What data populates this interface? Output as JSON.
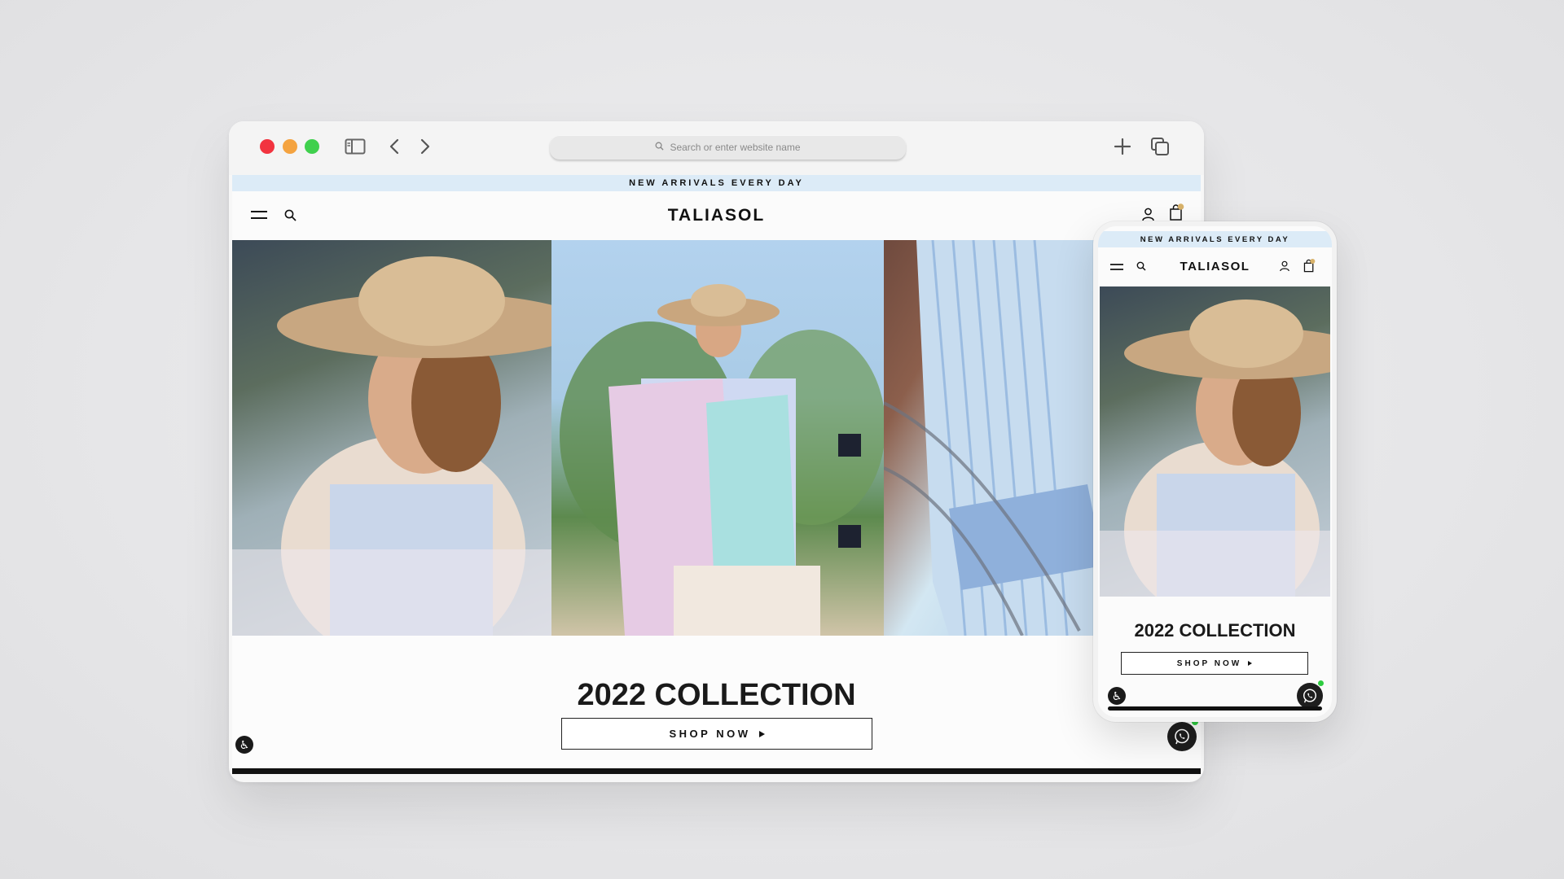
{
  "browser": {
    "address_placeholder": "Search or enter website name",
    "controls": {
      "close": "red-dot",
      "minimize": "yellow-dot",
      "zoom": "green-dot",
      "sidebar": "sidebar-icon",
      "back": "chevron-left-icon",
      "forward": "chevron-right-icon",
      "new_tab": "plus-icon",
      "tabs": "tabs-icon"
    }
  },
  "site": {
    "announcement": "NEW ARRIVALS EVERY DAY",
    "logo": "TALIASOL",
    "header_icons": [
      "menu-icon",
      "search-icon",
      "account-icon",
      "cart-icon"
    ],
    "collection_title": "2022 COLLECTION",
    "shop_now": "SHOP NOW",
    "floating": [
      "accessibility-icon",
      "whatsapp-icon"
    ]
  },
  "mobile": {
    "announcement": "NEW ARRIVALS EVERY DAY",
    "logo": "TALIASOL",
    "collection_title": "2022 COLLECTION",
    "shop_now": "SHOP NOW"
  },
  "colors": {
    "announcement_bg": "#dcebf7",
    "traffic_red": "#f2333f",
    "traffic_yellow": "#f4a340",
    "traffic_green": "#3fd04d",
    "whatsapp_status": "#2ecc40",
    "text_dark": "#1a1a1a"
  }
}
